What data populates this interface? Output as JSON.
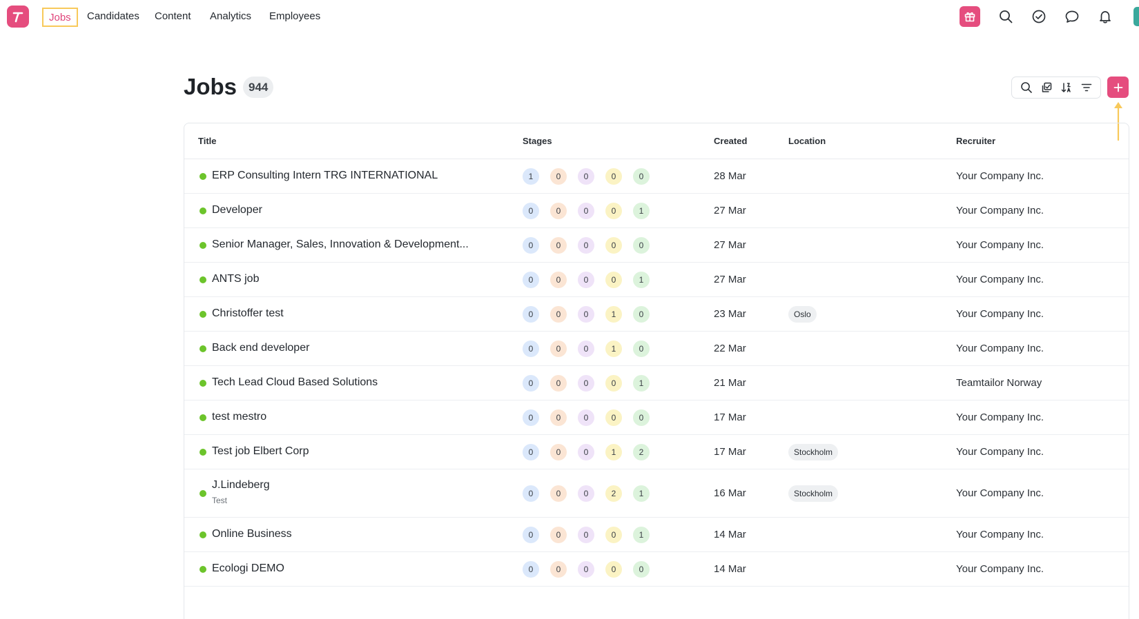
{
  "nav": {
    "items": [
      "Jobs",
      "Candidates",
      "Content",
      "Analytics",
      "Employees"
    ],
    "active": "Jobs",
    "right_icons": [
      "gift-icon",
      "search-icon",
      "check-circle-icon",
      "chat-icon",
      "bell-icon"
    ]
  },
  "header": {
    "title": "Jobs",
    "count": "944",
    "tools": [
      "search-icon",
      "copy-icon",
      "sort-icon",
      "filter-icon"
    ],
    "add_icon": "plus-icon"
  },
  "colors": {
    "brand": "#e54d7e",
    "highlight": "#f8c95a",
    "status_active": "#6cc42b"
  },
  "table": {
    "columns": {
      "title": "Title",
      "stages": "Stages",
      "created": "Created",
      "location": "Location",
      "recruiter": "Recruiter"
    },
    "rows": [
      {
        "title": "ERP Consulting Intern TRG INTERNATIONAL",
        "subtitle": "",
        "stages": [
          "1",
          "0",
          "0",
          "0",
          "0"
        ],
        "created": "28 Mar",
        "location": "",
        "recruiter": "Your Company Inc."
      },
      {
        "title": "Developer",
        "subtitle": "",
        "stages": [
          "0",
          "0",
          "0",
          "0",
          "1"
        ],
        "created": "27 Mar",
        "location": "",
        "recruiter": "Your Company Inc."
      },
      {
        "title": "Senior Manager, Sales, Innovation & Development...",
        "subtitle": "",
        "stages": [
          "0",
          "0",
          "0",
          "0",
          "0"
        ],
        "created": "27 Mar",
        "location": "",
        "recruiter": "Your Company Inc."
      },
      {
        "title": "ANTS job",
        "subtitle": "",
        "stages": [
          "0",
          "0",
          "0",
          "0",
          "1"
        ],
        "created": "27 Mar",
        "location": "",
        "recruiter": "Your Company Inc."
      },
      {
        "title": "Christoffer test",
        "subtitle": "",
        "stages": [
          "0",
          "0",
          "0",
          "1",
          "0"
        ],
        "created": "23 Mar",
        "location": "Oslo",
        "recruiter": "Your Company Inc."
      },
      {
        "title": "Back end developer",
        "subtitle": "",
        "stages": [
          "0",
          "0",
          "0",
          "1",
          "0"
        ],
        "created": "22 Mar",
        "location": "",
        "recruiter": "Your Company Inc."
      },
      {
        "title": "Tech Lead Cloud Based Solutions",
        "subtitle": "",
        "stages": [
          "0",
          "0",
          "0",
          "0",
          "1"
        ],
        "created": "21 Mar",
        "location": "",
        "recruiter": "Teamtailor Norway"
      },
      {
        "title": "test mestro",
        "subtitle": "",
        "stages": [
          "0",
          "0",
          "0",
          "0",
          "0"
        ],
        "created": "17 Mar",
        "location": "",
        "recruiter": "Your Company Inc."
      },
      {
        "title": "Test job Elbert Corp",
        "subtitle": "",
        "stages": [
          "0",
          "0",
          "0",
          "1",
          "2"
        ],
        "created": "17 Mar",
        "location": "Stockholm",
        "recruiter": "Your Company Inc."
      },
      {
        "title": "J.Lindeberg",
        "subtitle": "Test",
        "stages": [
          "0",
          "0",
          "0",
          "2",
          "1"
        ],
        "created": "16 Mar",
        "location": "Stockholm",
        "recruiter": "Your Company Inc."
      },
      {
        "title": "Online Business",
        "subtitle": "",
        "stages": [
          "0",
          "0",
          "0",
          "0",
          "1"
        ],
        "created": "14 Mar",
        "location": "",
        "recruiter": "Your Company Inc."
      },
      {
        "title": "Ecologi DEMO",
        "subtitle": "",
        "stages": [
          "0",
          "0",
          "0",
          "0",
          "0"
        ],
        "created": "14 Mar",
        "location": "",
        "recruiter": "Your Company Inc."
      }
    ]
  }
}
